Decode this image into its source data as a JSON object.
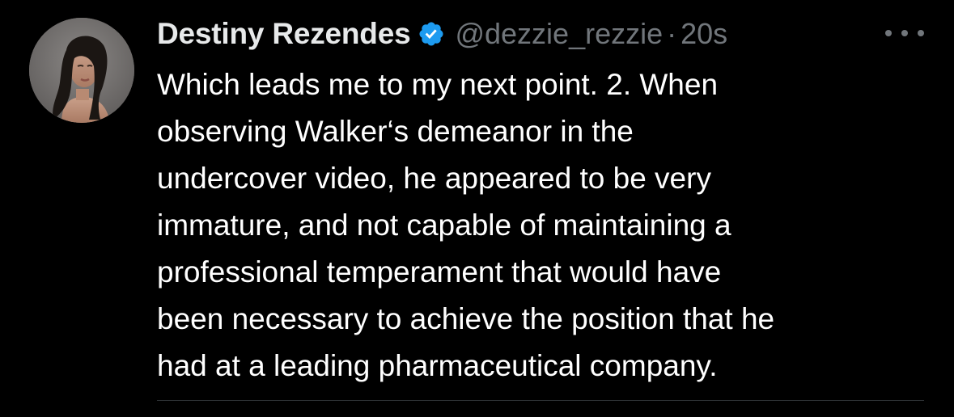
{
  "tweet": {
    "author": {
      "display_name": "Destiny Rezendes",
      "handle": "@dezzie_rezzie",
      "verified": true,
      "avatar_icon": "profile-photo"
    },
    "separator": "·",
    "timestamp": "20s",
    "more_icon": "more-horizontal-icon",
    "text_lines": [
      "Which leads me to my next point. 2. When",
      "observing Walker‘s demeanor in the",
      "undercover video, he appeared to be very",
      "immature, and not capable of maintaining a",
      "professional temperament that would have",
      "been necessary to achieve the position that he",
      "had at a leading pharmaceutical company."
    ]
  },
  "colors": {
    "background": "#000000",
    "name": "#e7e9ea",
    "muted": "#71767b",
    "body_text": "#ffffff",
    "verified_badge": "#1d9bf0",
    "divider": "#2f3336"
  }
}
